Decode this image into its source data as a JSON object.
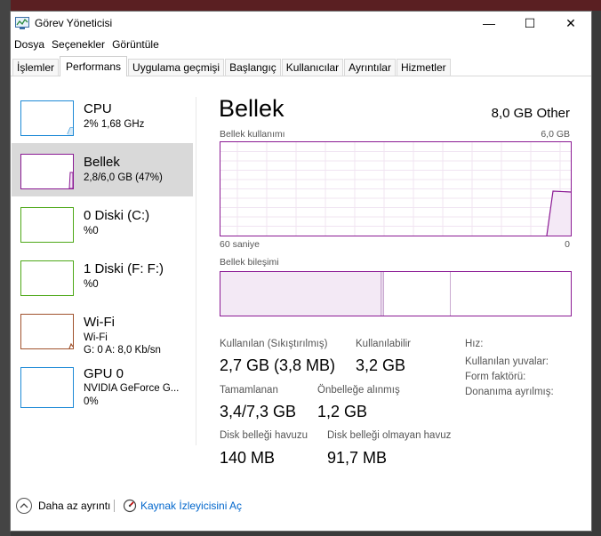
{
  "window": {
    "title": "Görev Yöneticisi"
  },
  "controls": {
    "minimize": "—",
    "maximize": "☐",
    "close": "✕"
  },
  "menu": [
    "Dosya",
    "Seçenekler",
    "Görüntüle"
  ],
  "tabs": [
    "İşlemler",
    "Performans",
    "Uygulama geçmişi",
    "Başlangıç",
    "Kullanıcılar",
    "Ayrıntılar",
    "Hizmetler"
  ],
  "sidebar": [
    {
      "name": "CPU",
      "sub": "2% 1,68 GHz",
      "sub2": "",
      "color": "#1e8ad6"
    },
    {
      "name": "Bellek",
      "sub": "2,8/6,0 GB (47%)",
      "sub2": "",
      "color": "#8b1a94"
    },
    {
      "name": "0 Diski (C:)",
      "sub": "%0",
      "sub2": "",
      "color": "#4da817"
    },
    {
      "name": "1 Diski (F: F:)",
      "sub": "%0",
      "sub2": "",
      "color": "#4da817"
    },
    {
      "name": "Wi-Fi",
      "sub": "Wi-Fi",
      "sub2": "G: 0 A: 8,0 Kb/sn",
      "color": "#a0522d"
    },
    {
      "name": "GPU 0",
      "sub": "NVIDIA GeForce G...",
      "sub2": "0%",
      "color": "#1e8ad6"
    }
  ],
  "panel": {
    "title": "Bellek",
    "total": "8,0 GB Other",
    "usage_label": "Bellek kullanımı",
    "usage_max": "6,0 GB",
    "time_left": "60 saniye",
    "time_right": "0",
    "composition_label": "Bellek bileşimi"
  },
  "stats": {
    "in_use_label": "Kullanılan (Sıkıştırılmış)",
    "in_use_value": "2,7 GB (3,8 MB)",
    "available_label": "Kullanılabilir",
    "available_value": "3,2 GB",
    "committed_label": "Tamamlanan",
    "committed_value": "3,4/7,3 GB",
    "cached_label": "Önbelleğe alınmış",
    "cached_value": "1,2 GB",
    "paged_label": "Disk belleği havuzu",
    "paged_value": "140 MB",
    "nonpaged_label": "Disk belleği olmayan havuz",
    "nonpaged_value": "91,7 MB",
    "speed_label": "Hız:",
    "slots_label": "Kullanılan yuvalar:",
    "form_label": "Form faktörü:",
    "reserved_label": "Donanıma ayrılmış:"
  },
  "footer": {
    "fewer": "Daha az ayrıntı",
    "resmon": "Kaynak İzleyicisini Aç"
  },
  "accent": {
    "memory": "#8b1a94",
    "link": "#0066cc"
  }
}
